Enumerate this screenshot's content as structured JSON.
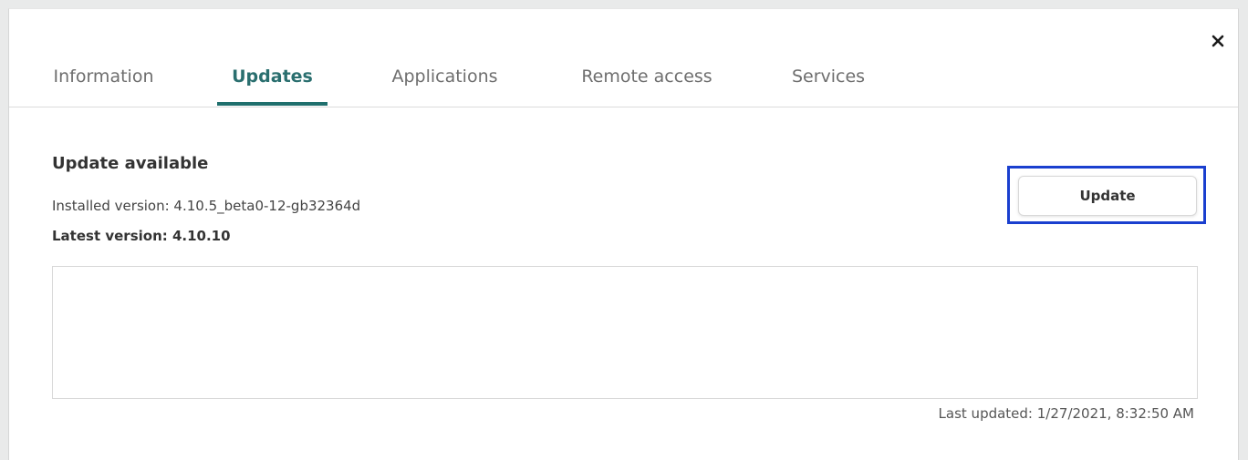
{
  "dialog": {
    "close_icon": "close-icon"
  },
  "tabs": [
    {
      "label": "Information",
      "active": false
    },
    {
      "label": "Updates",
      "active": true
    },
    {
      "label": "Applications",
      "active": false
    },
    {
      "label": "Remote access",
      "active": false
    },
    {
      "label": "Services",
      "active": false
    }
  ],
  "updates": {
    "title": "Update available",
    "installed_version": "Installed version: 4.10.5_beta0-12-gb32364d",
    "latest_version": "Latest version: 4.10.10",
    "update_button_label": "Update",
    "log_text": "",
    "last_updated": "Last updated: 1/27/2021, 8:32:50 AM"
  },
  "colors": {
    "accent": "#1f6f6d",
    "highlight_border": "#1a3fcf"
  }
}
